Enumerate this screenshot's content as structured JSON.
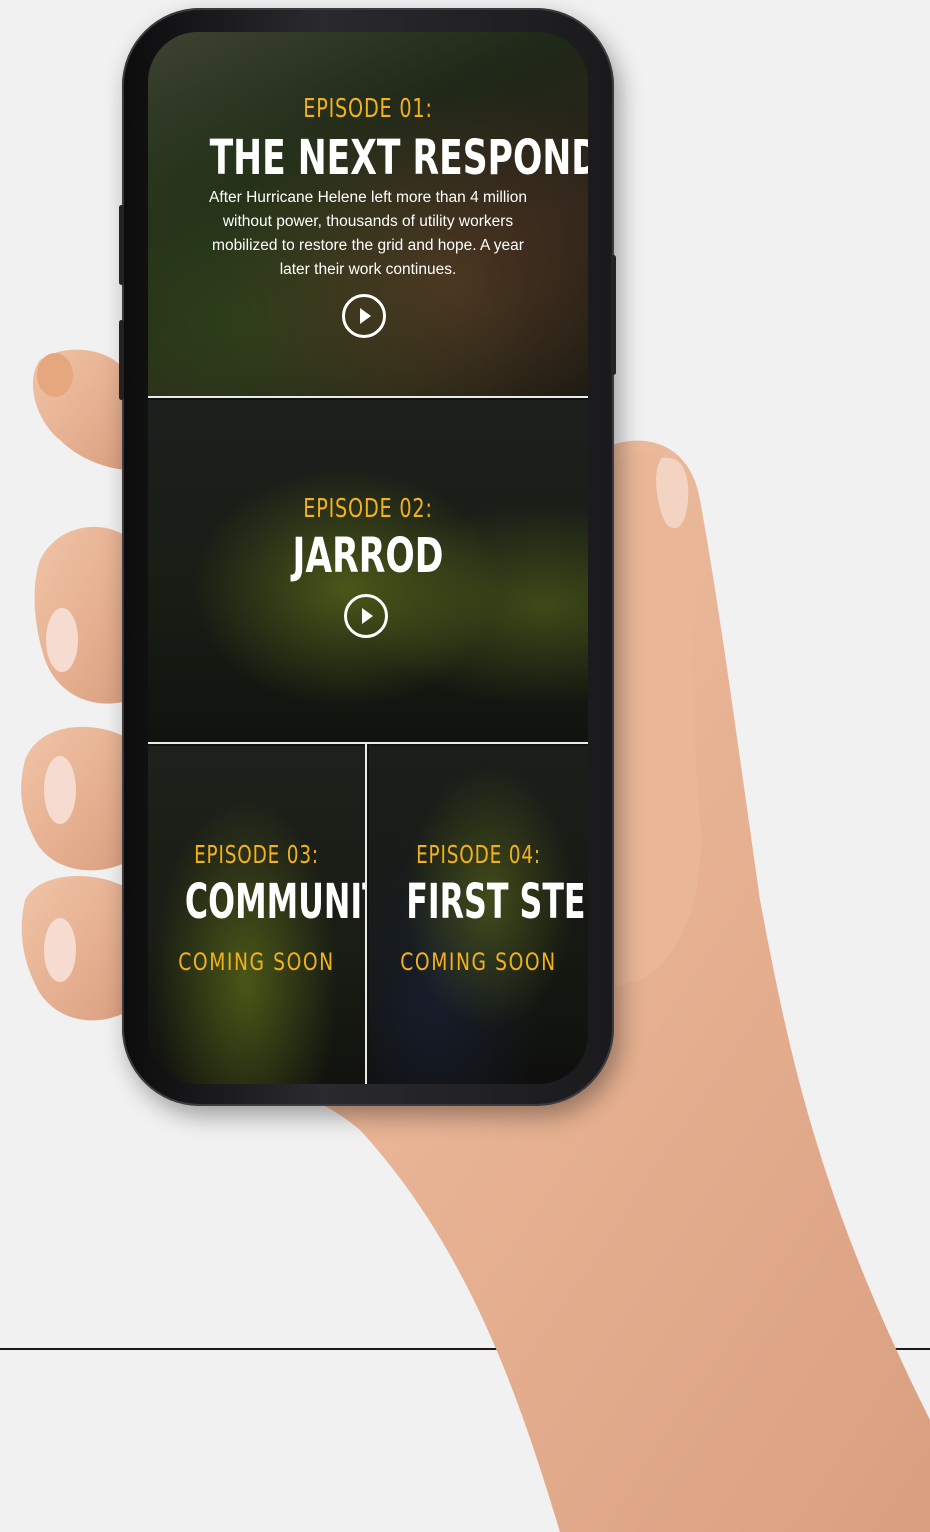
{
  "episodes": [
    {
      "label": "EPISODE 01:",
      "title": "THE NEXT RESPONDERS",
      "description": "After Hurricane Helene left more than 4 million without power, thousands of utility workers mobilized to restore the grid and hope. A year later their work continues.",
      "action_icon": "play-icon"
    },
    {
      "label": "EPISODE 02:",
      "title": "JARROD",
      "action_icon": "play-icon"
    },
    {
      "label": "EPISODE 03:",
      "title": "COMMUNITY",
      "status": "COMING SOON"
    },
    {
      "label": "EPISODE 04:",
      "title": "FIRST STEPS",
      "status": "COMING SOON"
    }
  ],
  "colors": {
    "accent": "#f3b21b",
    "background": "#f1f1f1",
    "phone_frame": "#1a1a1d"
  }
}
